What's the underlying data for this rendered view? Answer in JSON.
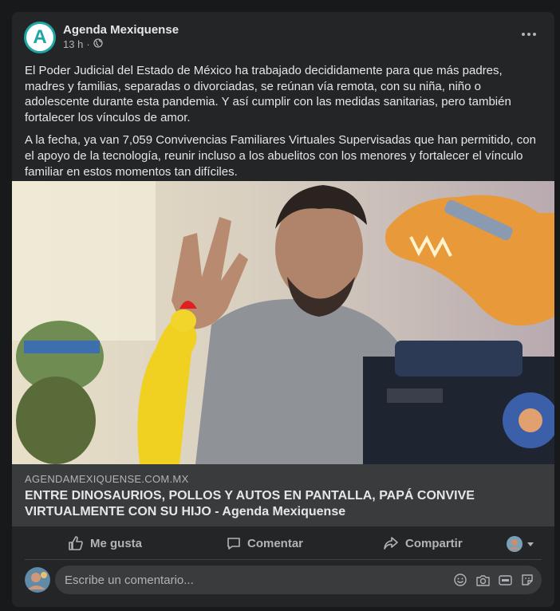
{
  "post": {
    "page_name": "Agenda Mexiquense",
    "avatar_letter": "A",
    "time": "13 h",
    "separator": "·",
    "paragraphs": [
      "El Poder Judicial del Estado de México ha trabajado decididamente para que más padres, madres y familias, separadas o divorciadas, se reúnan vía remota, con su niña, niño o adolescente durante esta pandemia. Y así cumplir con las medidas sanitarias, pero también fortalecer los vínculos de amor.",
      "A la fecha, ya van 7,059 Convivencias Familiares Virtuales Supervisadas que han permitido, con el apoyo de la tecnología, reunir incluso a los abuelitos con los menores y fortalecer el vínculo familiar en estos momentos tan difíciles."
    ]
  },
  "link": {
    "domain": "AGENDAMEXIQUENSE.COM.MX",
    "title": "ENTRE DINOSAURIOS, POLLOS Y AUTOS EN PANTALLA, PAPÁ CONVIVE VIRTUALMENTE CON SU HIJO - Agenda Mexiquense"
  },
  "actions": {
    "like": "Me gusta",
    "comment": "Comentar",
    "share": "Compartir"
  },
  "comment_box": {
    "placeholder": "Escribe un comentario..."
  },
  "colors": {
    "background": "#18191a",
    "card": "#242526",
    "accent_avatar": "#1fa6a4"
  }
}
